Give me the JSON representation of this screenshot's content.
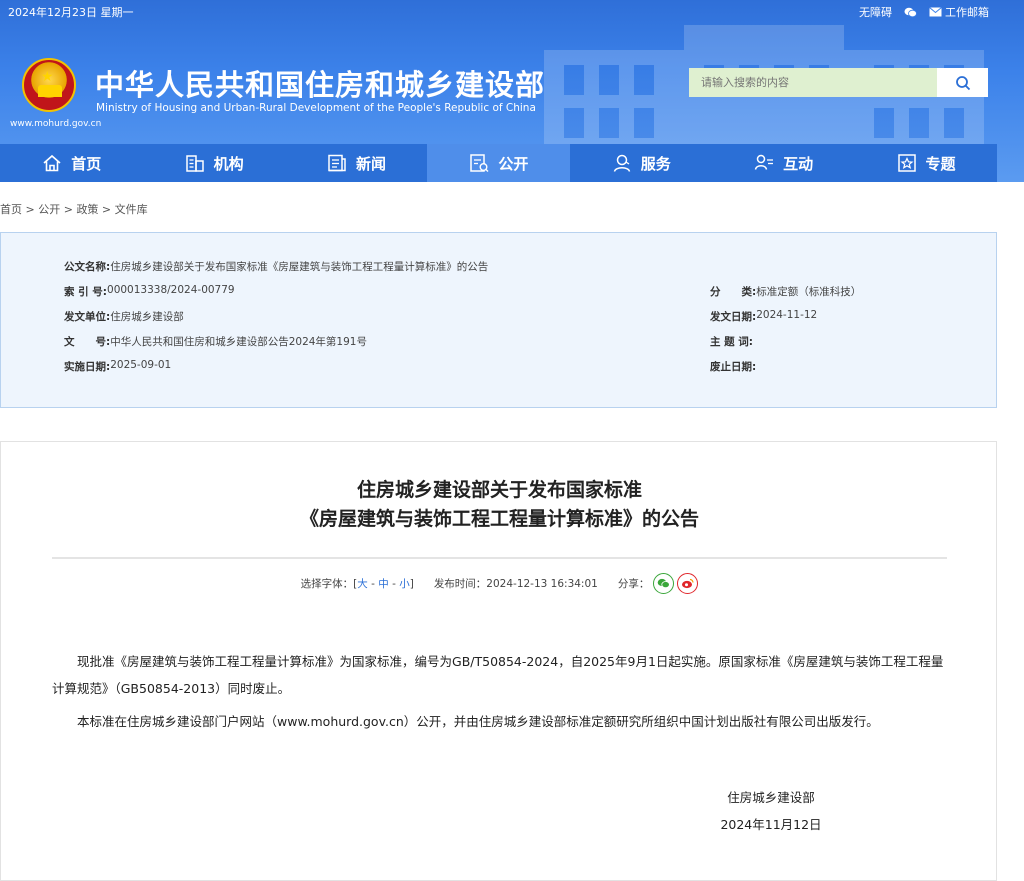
{
  "topbar": {
    "date": "2024年12月23日 星期一",
    "accessibility": "无障碍",
    "wechat_icon": "wechat-icon",
    "mail_icon": "mail-icon",
    "mail_label": "工作邮箱"
  },
  "header": {
    "url": "www.mohurd.gov.cn",
    "title_cn": "中华人民共和国住房和城乡建设部",
    "title_en": "Ministry of Housing and Urban-Rural Development of the People's Republic of China",
    "search_placeholder": "请输入搜索的内容"
  },
  "nav": [
    {
      "label": "首页",
      "icon": "home-icon"
    },
    {
      "label": "机构",
      "icon": "building-icon"
    },
    {
      "label": "新闻",
      "icon": "news-icon"
    },
    {
      "label": "公开",
      "icon": "document-icon",
      "active": true
    },
    {
      "label": "服务",
      "icon": "user-service-icon"
    },
    {
      "label": "互动",
      "icon": "interaction-icon"
    },
    {
      "label": "专题",
      "icon": "topic-icon"
    }
  ],
  "breadcrumb": [
    "首页",
    "公开",
    "政策",
    "文件库"
  ],
  "info": {
    "name_label": "公文名称:",
    "name_value": "住房城乡建设部关于发布国家标准《房屋建筑与装饰工程工程量计算标准》的公告",
    "index_label": "索 引 号:",
    "index_value": "000013338/2024-00779",
    "unit_label": "发文单位:",
    "unit_value": "住房城乡建设部",
    "docno_label": "文　　号:",
    "docno_value": "中华人民共和国住房和城乡建设部公告2024年第191号",
    "impl_label": "实施日期:",
    "impl_value": "2025-09-01",
    "category_label": "分　　类:",
    "category_value": "标准定额（标准科技）",
    "date_label": "发文日期:",
    "date_value": "2024-11-12",
    "subject_label": "主 题 词:",
    "subject_value": "",
    "abolish_label": "废止日期:",
    "abolish_value": ""
  },
  "article": {
    "title_line1": "住房城乡建设部关于发布国家标准",
    "title_line2": "《房屋建筑与装饰工程工程量计算标准》的公告",
    "font_label": "选择字体：[",
    "size_large": "大",
    "size_medium": "中",
    "size_small": "小",
    "font_close": "]",
    "publish_label": "发布时间：2024-12-13 16:34:01",
    "share_label": "分享：",
    "para1": "现批准《房屋建筑与装饰工程工程量计算标准》为国家标准，编号为GB/T50854-2024，自2025年9月1日起实施。原国家标准《房屋建筑与装饰工程工程量计算规范》（GB50854-2013）同时废止。",
    "para2": "本标准在住房城乡建设部门户网站（www.mohurd.gov.cn）公开，并由住房城乡建设部标准定额研究所组织中国计划出版社有限公司出版发行。",
    "sign_org": "住房城乡建设部",
    "sign_date": "2024年11月12日"
  },
  "colors": {
    "nav": "#2b6fd6",
    "nav_active": "#4f8eea",
    "search_bg": "#dff0d0",
    "info_bg": "#eef5fd"
  }
}
